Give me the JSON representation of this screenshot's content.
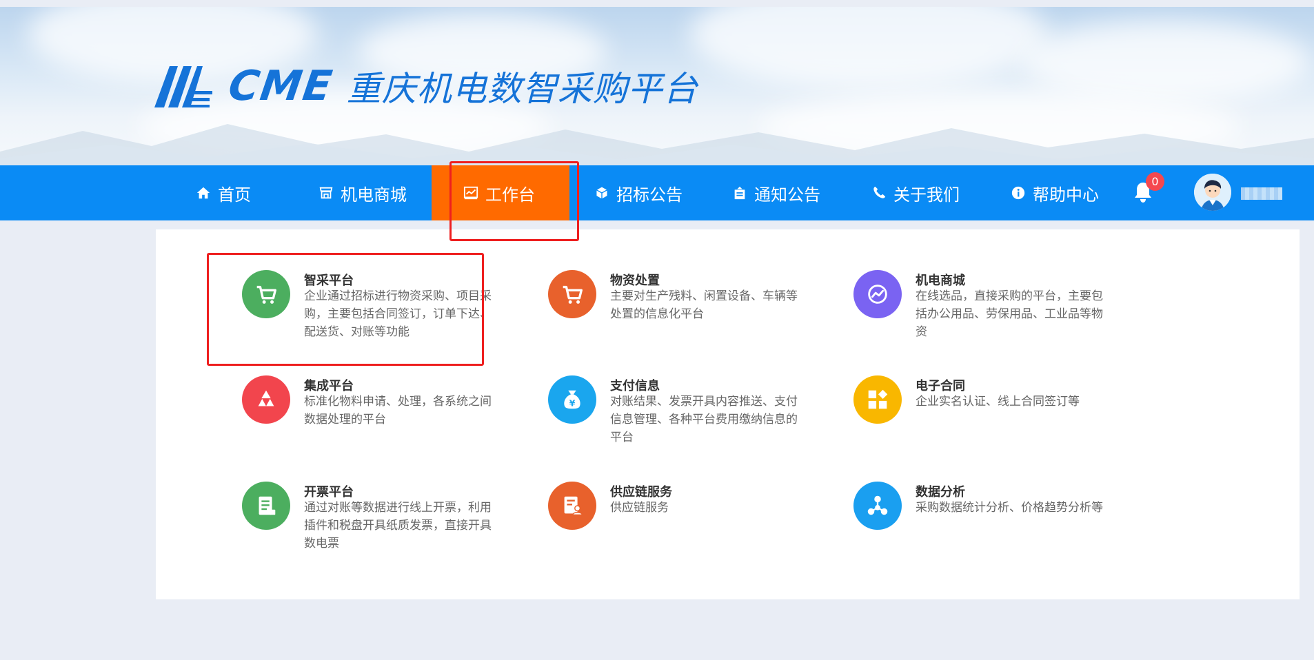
{
  "brand": {
    "logo_text": "CME",
    "title": "重庆机电数智采购平台",
    "primary_color": "#1573d8"
  },
  "nav": {
    "bg_color": "#0a8bf5",
    "active_color": "#ff6a00",
    "items": [
      {
        "label": "首页",
        "icon": "home-icon"
      },
      {
        "label": "机电商城",
        "icon": "store-icon"
      },
      {
        "label": "工作台",
        "icon": "chart-icon",
        "active": true
      },
      {
        "label": "招标公告",
        "icon": "cube-icon"
      },
      {
        "label": "通知公告",
        "icon": "notice-icon"
      },
      {
        "label": "关于我们",
        "icon": "phone-icon"
      },
      {
        "label": "帮助中心",
        "icon": "info-icon"
      }
    ],
    "notifications_count": "0"
  },
  "cards": [
    {
      "title": "智采平台",
      "desc": "企业通过招标进行物资采购、项目采购，主要包括合同签订，订单下达、配送货、对账等功能",
      "icon": "cart-icon",
      "color": "#4cae5f"
    },
    {
      "title": "物资处置",
      "desc": "主要对生产残料、闲置设备、车辆等处置的信息化平台",
      "icon": "cart-icon",
      "color": "#e8612c"
    },
    {
      "title": "机电商城",
      "desc": "在线选品，直接采购的平台，主要包括办公用品、劳保用品、工业品等物资",
      "icon": "trend-icon",
      "color": "#7a63f2"
    },
    {
      "title": "集成平台",
      "desc": "标准化物料申请、处理，各系统之间数据处理的平台",
      "icon": "recycle-icon",
      "color": "#f2454d"
    },
    {
      "title": "支付信息",
      "desc": "对账结果、发票开具内容推送、支付信息管理、各种平台费用缴纳信息的平台",
      "icon": "money-bag-icon",
      "color": "#1aa6ee"
    },
    {
      "title": "电子合同",
      "desc": "企业实名认证、线上合同签订等",
      "icon": "blocks-icon",
      "color": "#f9b700"
    },
    {
      "title": "开票平台",
      "desc": "通过对账等数据进行线上开票，利用插件和税盘开具纸质发票，直接开具数电票",
      "icon": "invoice-icon",
      "color": "#4cae5f"
    },
    {
      "title": "供应链服务",
      "desc": "供应链服务",
      "icon": "document-user-icon",
      "color": "#e8612c"
    },
    {
      "title": "数据分析",
      "desc": "采购数据统计分析、价格趋势分析等",
      "icon": "network-icon",
      "color": "#1a9ff0"
    }
  ]
}
